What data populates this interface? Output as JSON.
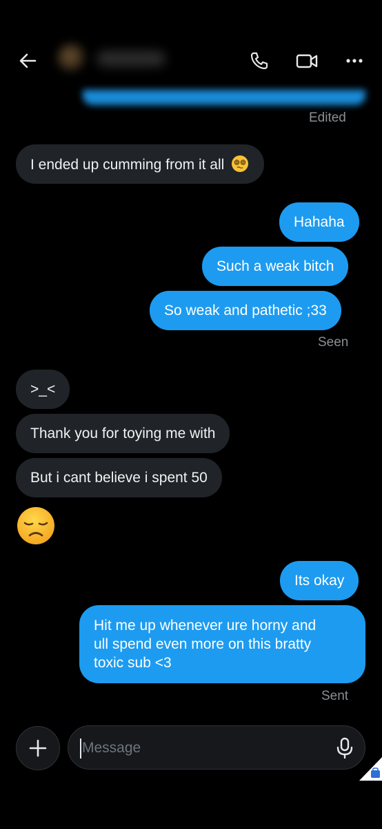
{
  "colors": {
    "background": "#000000",
    "outgoing_bubble": "#1d9bf0",
    "incoming_bubble": "#202327",
    "meta_text": "#8b8f93"
  },
  "header": {
    "back_icon": "arrow-left-icon",
    "call_icon": "phone-icon",
    "video_icon": "video-camera-icon",
    "more_icon": "more-horizontal-icon"
  },
  "messages": {
    "top_status": "Edited",
    "m1": "I ended up cumming from it all",
    "m1_emoji": "dizzy-face-emoji",
    "m2": "Hahaha",
    "m3": "Such a weak bitch",
    "m4": "So weak and pathetic ;33",
    "status_seen": "Seen",
    "m5": ">_<",
    "m6": "Thank you for toying me with",
    "m7": "But i cant believe i spent 50",
    "m8_emoji": "disappointed-face-emoji",
    "m9": "Its okay",
    "m10_line1": "Hit me up whenever ure horny and",
    "m10_line2": "ull spend even more on this bratty",
    "m10_line3": "toxic sub <3",
    "status_sent": "Sent"
  },
  "composer": {
    "plus_icon": "plus-icon",
    "placeholder": "Message",
    "mic_icon": "microphone-icon"
  }
}
